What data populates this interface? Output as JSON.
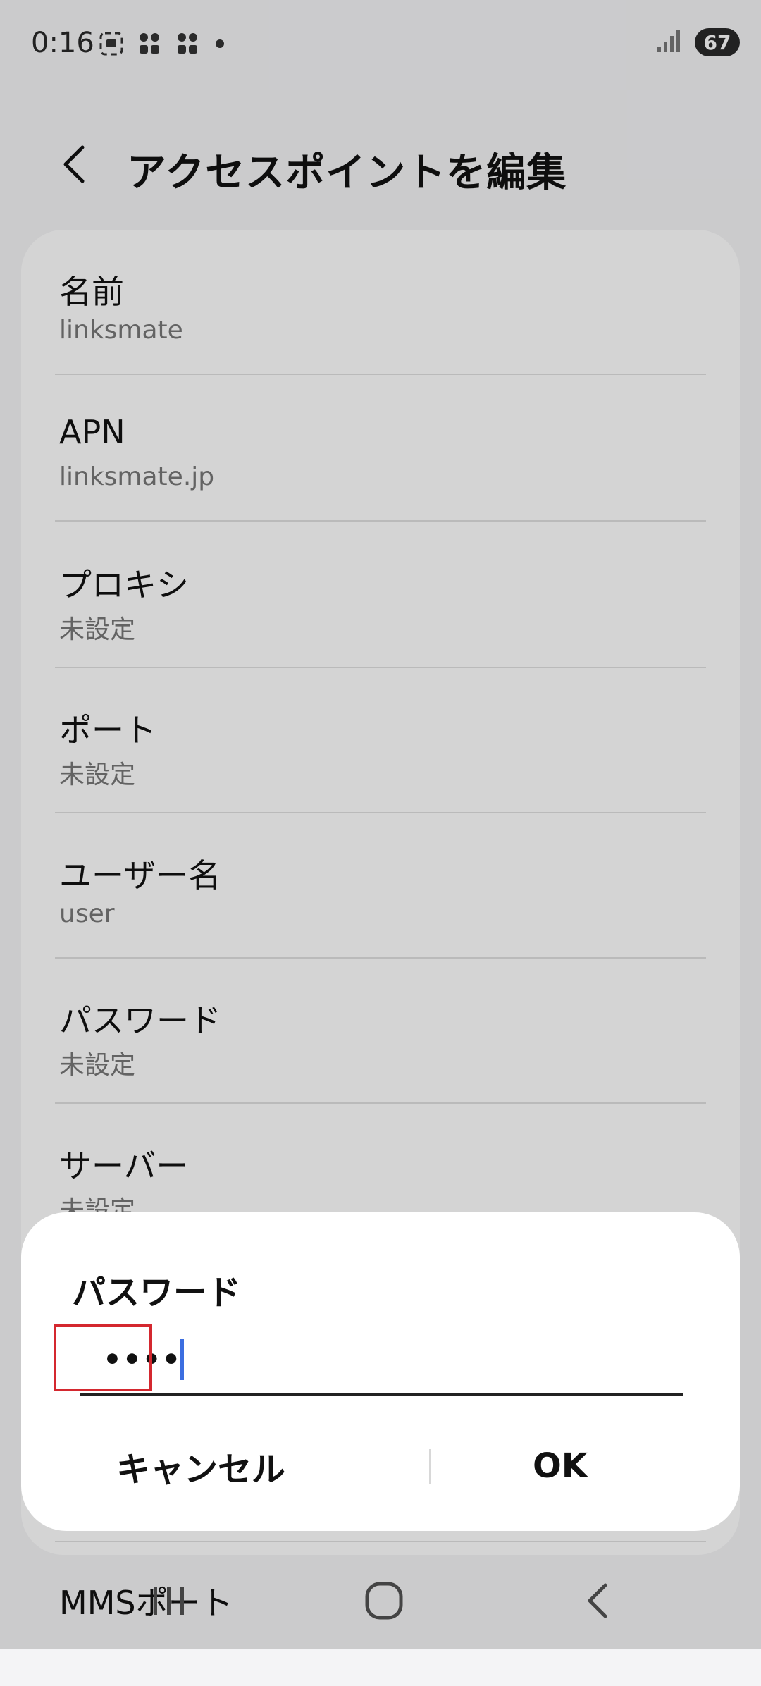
{
  "status_bar": {
    "time": "0:16",
    "battery": "67",
    "icons": [
      "screenshot-icon",
      "notification-icon",
      "notification-icon",
      "dot-icon",
      "signal-icon"
    ]
  },
  "header": {
    "title": "アクセスポイントを編集",
    "back_icon": "chevron-left-icon"
  },
  "settings": {
    "items": [
      {
        "label": "名前",
        "value": "linksmate"
      },
      {
        "label": "APN",
        "value": "linksmate.jp"
      },
      {
        "label": "プロキシ",
        "value": "未設定"
      },
      {
        "label": "ポート",
        "value": "未設定"
      },
      {
        "label": "ユーザー名",
        "value": "user"
      },
      {
        "label": "パスワード",
        "value": "未設定"
      },
      {
        "label": "サーバー",
        "value": "未設定"
      },
      {
        "label": "MMSポート",
        "value": ""
      }
    ]
  },
  "dialog": {
    "title": "パスワード",
    "password_masked": "••••",
    "cancel_label": "キャンセル",
    "ok_label": "OK"
  },
  "nav_bar": {
    "icons": [
      "recents-icon",
      "home-icon",
      "back-icon"
    ]
  },
  "colors": {
    "background": "#f4f4f6",
    "card": "#ffffff",
    "caret": "#3c6ee0",
    "highlight": "#d4282f"
  }
}
